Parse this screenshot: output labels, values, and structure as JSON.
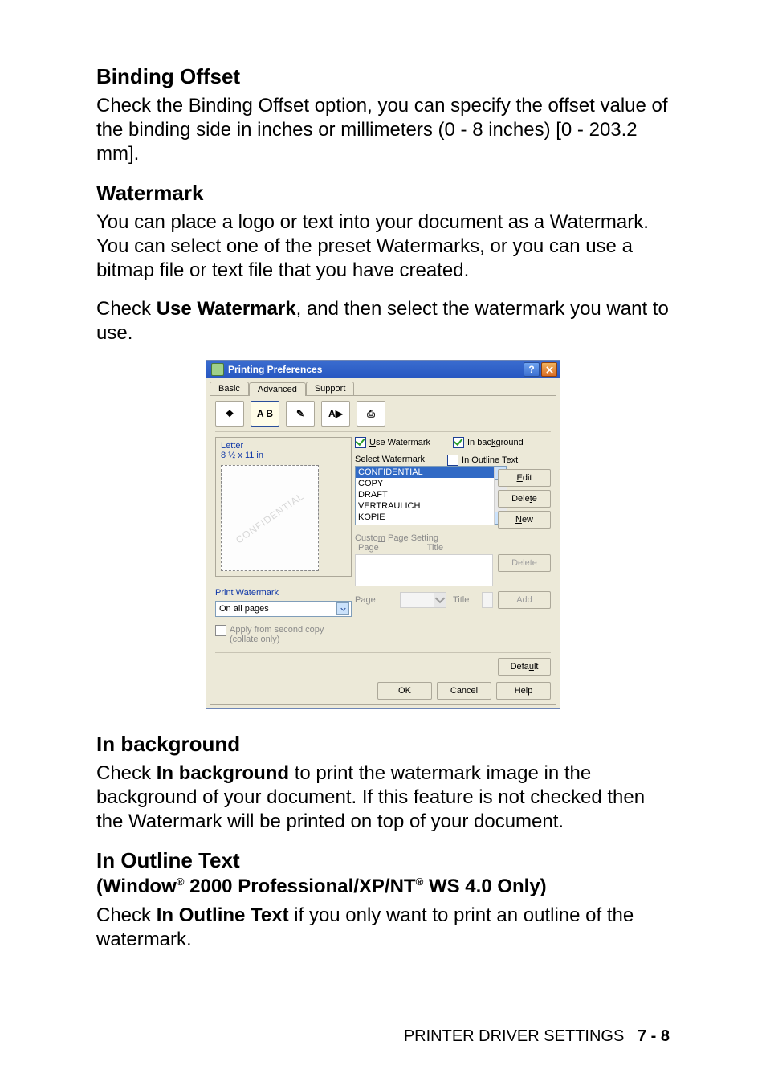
{
  "section1": {
    "heading": "Binding Offset",
    "body": "Check the Binding Offset option, you can specify the offset value of the binding side in inches or millimeters (0 - 8 inches) [0 - 203.2 mm]."
  },
  "section2": {
    "heading": "Watermark",
    "body1": "You can place a logo or text into your document as a Watermark. You can select one of the preset Watermarks, or you can use a bitmap file or text file that you have created.",
    "body2_pre": "Check ",
    "body2_bold": "Use Watermark",
    "body2_post": ", and then select the watermark you want to use."
  },
  "dialog": {
    "title": "Printing Preferences",
    "tabs": {
      "basic": "Basic",
      "advanced": "Advanced",
      "support": "Support"
    },
    "toolbar_icons": {
      "i1": "❖",
      "i2": "A B",
      "i3": "✎",
      "i4": "A▶",
      "i5": "⎙"
    },
    "paper": {
      "name": "Letter",
      "size": "8 ½ x 11 in"
    },
    "preview_wm": "CONFIDENTIAL",
    "print_watermark_label": "Print Watermark",
    "print_watermark_value": "On all pages",
    "apply_second": "Apply from second copy\n(collate only)",
    "use_watermark": "Use Watermark",
    "in_background": "In background",
    "in_outline_text": "In Outline Text",
    "select_watermark": "Select Watermark",
    "list": [
      "CONFIDENTIAL",
      "COPY",
      "DRAFT",
      "VERTRAULICH",
      "KOPIE"
    ],
    "btn_edit": "Edit",
    "btn_delete": "Delete",
    "btn_new": "New",
    "custom_setting": "Custom Page Setting",
    "page_lbl": "Page",
    "title_lbl": "Title",
    "btn_delete2": "Delete",
    "btn_add": "Add",
    "btn_default": "Default",
    "btn_ok": "OK",
    "btn_cancel": "Cancel",
    "btn_help": "Help"
  },
  "section3": {
    "heading": "In background",
    "body_pre": "Check ",
    "body_bold": "In background",
    "body_post": " to print the watermark image in the background of your document. If this feature is not checked then the Watermark will be printed on top of your document."
  },
  "section4": {
    "heading": "In Outline Text",
    "sub_pre": "(Window",
    "sub_mid": " 2000 Professional/XP/NT",
    "sub_post": " WS 4.0 Only)",
    "body_pre": "Check ",
    "body_bold": "In Outline Text",
    "body_post": " if you only want to print an outline of the watermark."
  },
  "footer": {
    "left": "PRINTER DRIVER SETTINGS",
    "right": "7 - 8"
  }
}
